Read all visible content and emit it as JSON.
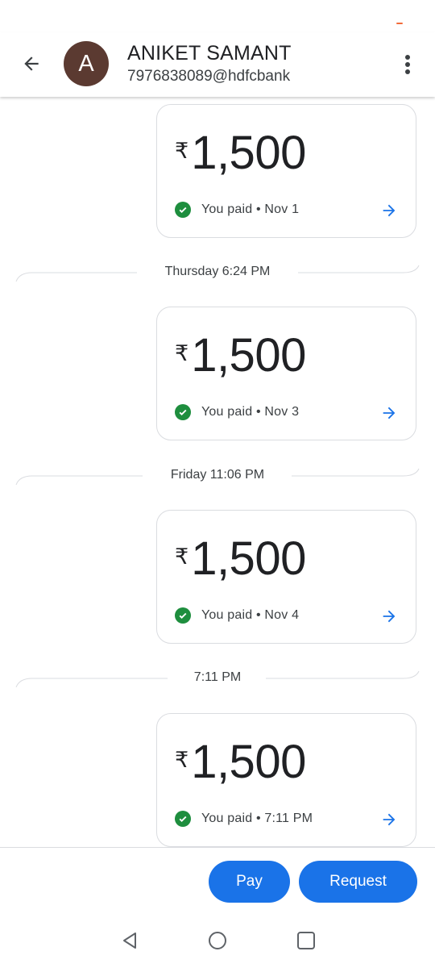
{
  "status_bar": {
    "indicator_color": "#f26b3a"
  },
  "header": {
    "back_icon": "arrow-left-icon",
    "avatar_initial": "A",
    "avatar_color": "#5b3a31",
    "contact_name": "ANIKET SAMANT",
    "contact_upi": "7976838089@hdfcbank",
    "menu_icon": "more-vertical-icon"
  },
  "feed": [
    {
      "kind": "payment",
      "currency": "₹",
      "amount": "1,500",
      "status": "You paid • Nov 1"
    },
    {
      "kind": "separator",
      "label": "Thursday 6:24 PM"
    },
    {
      "kind": "payment",
      "currency": "₹",
      "amount": "1,500",
      "status": "You paid • Nov 3"
    },
    {
      "kind": "separator",
      "label": "Friday 11:06 PM"
    },
    {
      "kind": "payment",
      "currency": "₹",
      "amount": "1,500",
      "status": "You paid • Nov 4"
    },
    {
      "kind": "separator",
      "label": "7:11 PM"
    },
    {
      "kind": "payment",
      "currency": "₹",
      "amount": "1,500",
      "status": "You paid • 7:11 PM"
    }
  ],
  "actions": {
    "pay_label": "Pay",
    "request_label": "Request",
    "accent_color": "#1a73e8"
  },
  "nav": {
    "back": "triangle-back-icon",
    "home": "circle-home-icon",
    "recents": "square-recents-icon"
  },
  "colors": {
    "success": "#1e8e3e",
    "link": "#1a73e8"
  }
}
